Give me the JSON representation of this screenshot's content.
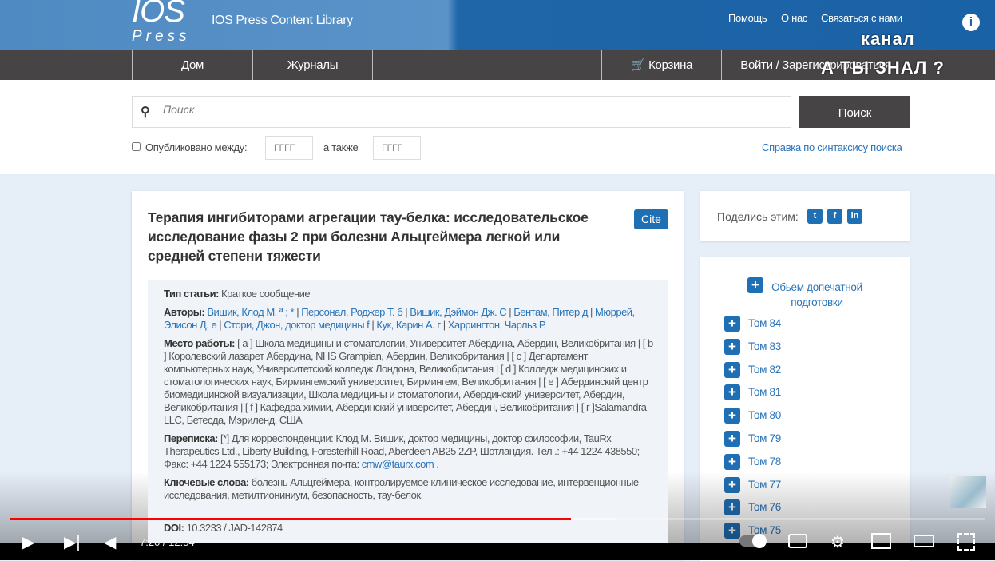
{
  "header": {
    "logo_top": "IOS",
    "logo_bottom": "Press",
    "library": "IOS Press Content Library",
    "links": [
      "Помощь",
      "О нас",
      "Связаться с нами"
    ],
    "info_icon": "i"
  },
  "nav": {
    "home": "Дом",
    "journals": "Журналы",
    "cart": "Корзина",
    "login": "Войти / Зарегистрироваться"
  },
  "overlay": {
    "line1": "канал",
    "line2": "А ТЫ ЗНАЛ ?"
  },
  "search": {
    "placeholder": "Поиск",
    "button": "Поиск",
    "published_between": "Опубликовано между:",
    "year_placeholder": "ГГГГ",
    "and": "а также",
    "syntax_help": "Справка по синтаксису поиска"
  },
  "article": {
    "title": "Терапия ингибиторами агрегации тау-белка: исследовательское исследование фазы 2 при болезни Альцгеймера легкой или средней степени тяжести",
    "cite": "Cite",
    "type_label": "Тип статьи:",
    "type": "Краткое сообщение",
    "authors_label": "Авторы:",
    "authors": [
      "Вишик, Клод М. ª ; *",
      "Персонал, Роджер Т. б",
      "Вишик, Дэймон Дж. С",
      "Бентам, Питер д",
      "Мюррей, Элисон Д. е",
      "Стори, Джон, доктор медицины f",
      "Кук, Карин А. г",
      "Харрингтон, Чарльз Р."
    ],
    "affil_label": "Место работы:",
    "affil": "[ a ] Школа медицины и стоматологии, Университет Абердина, Абердин, Великобритания | [ b ] Королевский лазарет Абердина, NHS Grampian, Абердин, Великобритания | [ c ] Департамент компьютерных наук, Университетский колледж Лондона, Великобритания | [ d ] Колледж медицинских и стоматологических наук, Бирмингемский университет, Бирмингем, Великобритания | [ e ] Абердинский центр биомедицинской визуализации, Школа медицины и стоматологии, Абердинский университет, Абердин, Великобритания | [ f ] Кафедра химии, Абердинский университет, Абердин, Великобритания | [ г ]Salamandra LLC, Бетесда, Мэриленд, США",
    "corr_label": "Переписка:",
    "corr": "[*] Для корреспонденции: Клод М. Вишик, доктор медицины, доктор философии, TauRx Therapeutics Ltd., Liberty Building, Foresterhill Road, Aberdeen AB25 2ZP, Шотландия. Тел .: +44 1224 438550; Факс: +44 1224 555173; Электронная почта:",
    "email": "cmw@taurx.com",
    "keywords_label": "Ключевые слова:",
    "keywords": "болезнь Альцгеймера, контролируемое клиническое исследование, интервенционные исследования, метилтиониниум, безопасность, тау-белок.",
    "doi_label": "DOI:",
    "doi": "10.3233 / JAD-142874"
  },
  "share": {
    "label": "Поделись этим:",
    "icons": [
      "twitter-icon",
      "facebook-icon",
      "linkedin-icon"
    ]
  },
  "volumes": {
    "prepress": "Обьем допечатной подготовки",
    "items": [
      "Том 84",
      "Том 83",
      "Том 82",
      "Том 81",
      "Том 80",
      "Том 79",
      "Том 78",
      "Том 77",
      "Том 76",
      "Том 75"
    ]
  },
  "player": {
    "time": "7:20 / 12:54",
    "progress": 0.575,
    "buffered": 0.62,
    "accent": "#ff0000"
  }
}
